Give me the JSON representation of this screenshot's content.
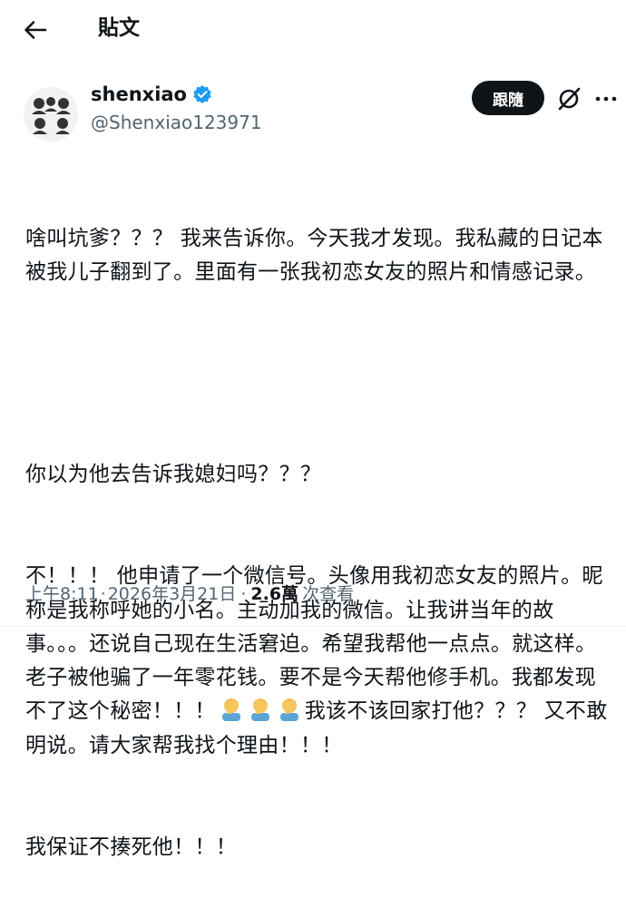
{
  "header": {
    "title": "貼文"
  },
  "author": {
    "display_name": "shenxiao",
    "handle": "@Shenxiao123971",
    "verified": true
  },
  "actions": {
    "follow_label": "跟隨"
  },
  "post": {
    "paragraph1": "啥叫坑爹？？？ 我来告诉你。今天我才发现。我私藏的日记本被我儿子翻到了。里面有一张我初恋女友的照片和情感记录。",
    "paragraph2_line1": "你以为他去告诉我媳妇吗？？？",
    "paragraph2_line2_before_emoji": "不！！！ 他申请了一个微信号。头像用我初恋女友的照片。昵称是我称呼她的小名。主动加我的微信。让我讲当年的故事。。。还说自己现在生活窘迫。希望我帮他一点点。就这样。老子被他骗了一年零花钱。要不是今天帮他修手机。我都发现不了这个秘密！！！",
    "paragraph2_line2_after_emoji": "我该不该回家打他？？？ 又不敢明说。请大家帮我找个理由！！！",
    "paragraph3": "我保证不揍死他！！！",
    "emoji": "facepalm-icon"
  },
  "meta": {
    "time": "上午8:11",
    "date": "2026年3月21日",
    "separator": "·",
    "views_count": "2.6萬",
    "views_label": "次查看"
  },
  "colors": {
    "verified_badge": "#1d9bf0",
    "muted_text": "#536471",
    "text": "#0f1419",
    "follow_bg": "#0f1419"
  }
}
